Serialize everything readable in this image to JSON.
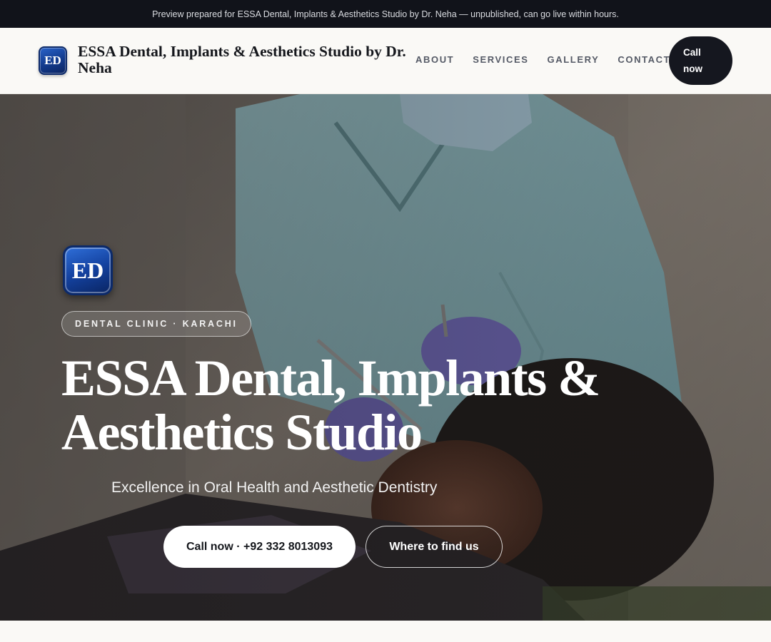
{
  "preview_bar": {
    "text": "Preview prepared for ESSA Dental, Implants & Aesthetics Studio by Dr. Neha — unpublished, can go live within hours."
  },
  "header": {
    "logo_initials": "ED",
    "brand_name": "ESSA Dental, Implants & Aesthetics Studio by Dr. Neha",
    "nav": [
      {
        "label": "ABOUT"
      },
      {
        "label": "SERVICES"
      },
      {
        "label": "GALLERY"
      },
      {
        "label": "CONTACT"
      }
    ],
    "call_button": "Call now"
  },
  "hero": {
    "badge_initials": "ED",
    "tag": "DENTAL CLINIC · KARACHI",
    "title_line1": "ESSA Dental, Implants &",
    "title_line2": "Aesthetics Studio",
    "subtitle": "Excellence in Oral Health and Aesthetic Dentistry",
    "primary_button": "Call now · +92 332 8013093",
    "secondary_button": "Where to find us",
    "image": "dentist treating patient photo"
  },
  "colors": {
    "dark": "#11131a",
    "page_bg": "#faf9f6",
    "brand_blue": "#1442a0",
    "scrub_teal": "#8fb9bf"
  }
}
